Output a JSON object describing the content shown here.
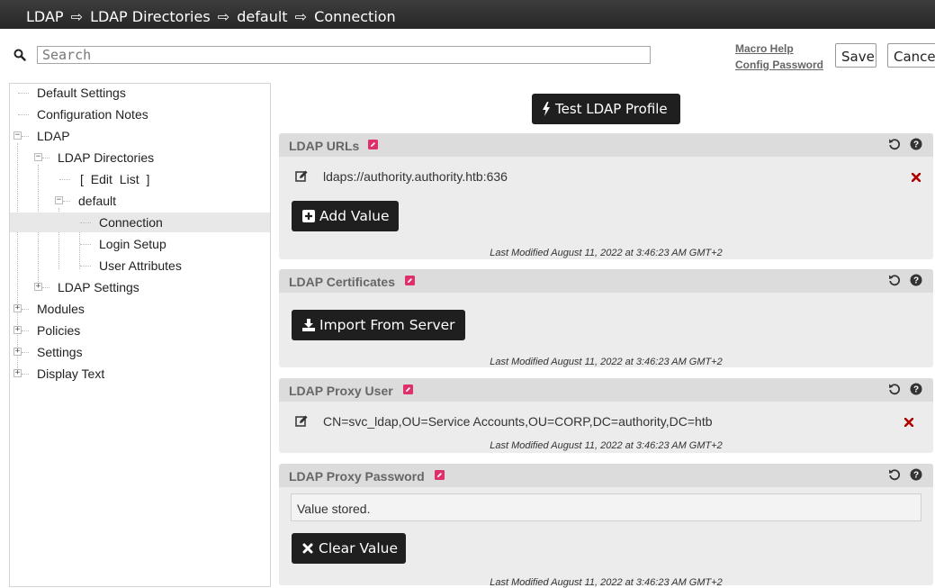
{
  "breadcrumb": {
    "items": [
      "LDAP",
      "LDAP Directories",
      "default",
      "Connection"
    ],
    "separator": "⇨"
  },
  "search": {
    "placeholder": "Search",
    "value": ""
  },
  "header_links": {
    "macro_help": "Macro Help",
    "config_password": "Config Password"
  },
  "header_buttons": {
    "save": "Save",
    "cancel": "Cancel"
  },
  "tree": {
    "items": [
      {
        "label": "Default Settings"
      },
      {
        "label": "Configuration Notes"
      },
      {
        "label": "LDAP",
        "state": "expanded"
      },
      {
        "label": "LDAP Directories",
        "state": "expanded"
      },
      {
        "label": "[ Edit List ]"
      },
      {
        "label": "default",
        "state": "expanded"
      },
      {
        "label": "Connection",
        "selected": true
      },
      {
        "label": "Login Setup"
      },
      {
        "label": "User Attributes"
      },
      {
        "label": "LDAP Settings",
        "state": "collapsed"
      },
      {
        "label": "Modules",
        "state": "collapsed"
      },
      {
        "label": "Policies",
        "state": "collapsed"
      },
      {
        "label": "Settings",
        "state": "collapsed"
      },
      {
        "label": "Display Text",
        "state": "collapsed"
      }
    ]
  },
  "test_button": {
    "label": "Test LDAP Profile",
    "icon": "bolt-icon"
  },
  "panels": [
    {
      "title": "LDAP URLs",
      "value": "ldaps://authority.authority.htb:636",
      "button": "Add Value",
      "modified": "Last Modified August 11, 2022 at 3:46:23 AM GMT+2"
    },
    {
      "title": "LDAP Certificates",
      "button": "Import From Server",
      "modified": "Last Modified August 11, 2022 at 3:46:23 AM GMT+2"
    },
    {
      "title": "LDAP Proxy User",
      "value": "CN=svc_ldap,OU=Service Accounts,OU=CORP,DC=authority,DC=htb",
      "modified": "Last Modified August 11, 2022 at 3:46:23 AM GMT+2"
    },
    {
      "title": "LDAP Proxy Password",
      "value": "Value stored.",
      "button": "Clear Value",
      "modified": "Last Modified August 11, 2022 at 3:46:23 AM GMT+2"
    }
  ],
  "colors": {
    "topbar": "#2f2f2f",
    "panel_bg": "#ececec",
    "panel_header": "#dcdcdc",
    "edit_icon": "#e0306a",
    "delete_icon": "#b00000",
    "dark_button": "#1f1f1f",
    "selected_row": "#e8e8e8"
  }
}
